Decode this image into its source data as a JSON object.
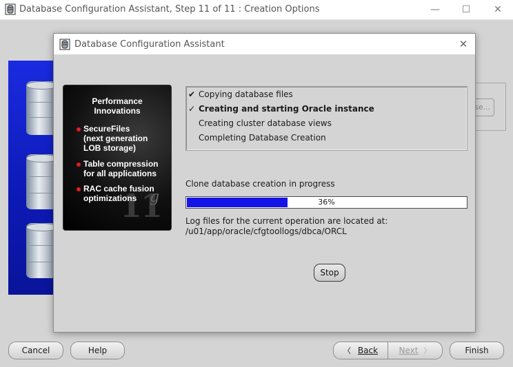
{
  "window": {
    "title": "Database Configuration Assistant, Step 11 of 11 : Creation Options",
    "minimize_glyph": "—",
    "maximize_glyph": "☐",
    "close_glyph": "✕"
  },
  "background": {
    "browse_fragment": "se..."
  },
  "dialog": {
    "title": "Database Configuration Assistant",
    "close_glyph": "✕",
    "promo": {
      "title_line1": "Performance",
      "title_line2": "Innovations",
      "items": [
        {
          "lines": [
            "SecureFiles",
            "(next generation",
            "LOB storage)"
          ]
        },
        {
          "lines": [
            "Table compression",
            "for all applications"
          ]
        },
        {
          "lines": [
            "RAC cache fusion",
            "optimizations"
          ]
        }
      ],
      "logo_11": "11",
      "logo_g": "g"
    },
    "steps": [
      {
        "label": "Copying database files",
        "state": "done",
        "mark": "✔"
      },
      {
        "label": "Creating and starting Oracle instance",
        "state": "current",
        "mark": "✓"
      },
      {
        "label": "Creating cluster database views",
        "state": "pending",
        "mark": ""
      },
      {
        "label": "Completing Database Creation",
        "state": "pending",
        "mark": ""
      }
    ],
    "status_text": "Clone database creation in progress",
    "progress": {
      "percent": 36,
      "label": "36%"
    },
    "log_label": "Log files for the current operation are located at:",
    "log_path": "/u01/app/oracle/cfgtoollogs/dbca/ORCL",
    "stop_label": "Stop"
  },
  "footer": {
    "cancel": "Cancel",
    "help": "Help",
    "back": "Back",
    "next": "Next",
    "finish": "Finish",
    "back_arrow": "〈",
    "next_arrow": "〉"
  },
  "colors": {
    "progress_fill": "#1414e6",
    "promo_bullet": "#e21d1d"
  }
}
